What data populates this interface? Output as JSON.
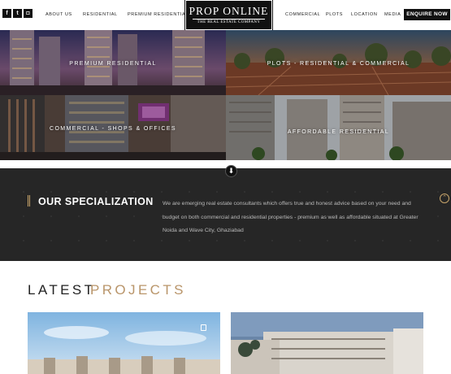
{
  "header": {
    "social": [
      {
        "icon": "facebook-icon",
        "glyph": "f"
      },
      {
        "icon": "twitter-icon",
        "glyph": "t"
      },
      {
        "icon": "instagram-icon",
        "glyph": "◘"
      }
    ],
    "nav_left": [
      "ABOUT US",
      "RESIDENTIAL",
      "PREMIUM RESIDENTIAL"
    ],
    "logo_title": "PROP ONLINE",
    "logo_subtitle": "THE REAL ESTATE COMPANY",
    "nav_right": [
      "COMMERCIAL",
      "PLOTS",
      "LOCATION",
      "MEDIA"
    ],
    "enquire_label": "ENQUIRE NOW"
  },
  "tiles": [
    {
      "label": "PREMIUM RESIDENTIAL"
    },
    {
      "label": "PLOTS - RESIDENTIAL & COMMERCIAL"
    },
    {
      "label": "COMMERCIAL - SHOPS & OFFICES"
    },
    {
      "label": "AFFORDABLE RESIDENTIAL"
    }
  ],
  "specialization": {
    "title": "OUR SPECIALIZATION",
    "text": "We are emerging real estate consultants which offers true and honest advice based on your need and budget on both commercial and residential properties - premium as well as affordable situated at Greater Noida and Wave City, Ghaziabad"
  },
  "latest": {
    "word1": "LATEST",
    "word2": "PROJECTS"
  },
  "colors": {
    "accent": "#c7a46a",
    "dark": "#262626",
    "header_bg": "#ffffff"
  }
}
